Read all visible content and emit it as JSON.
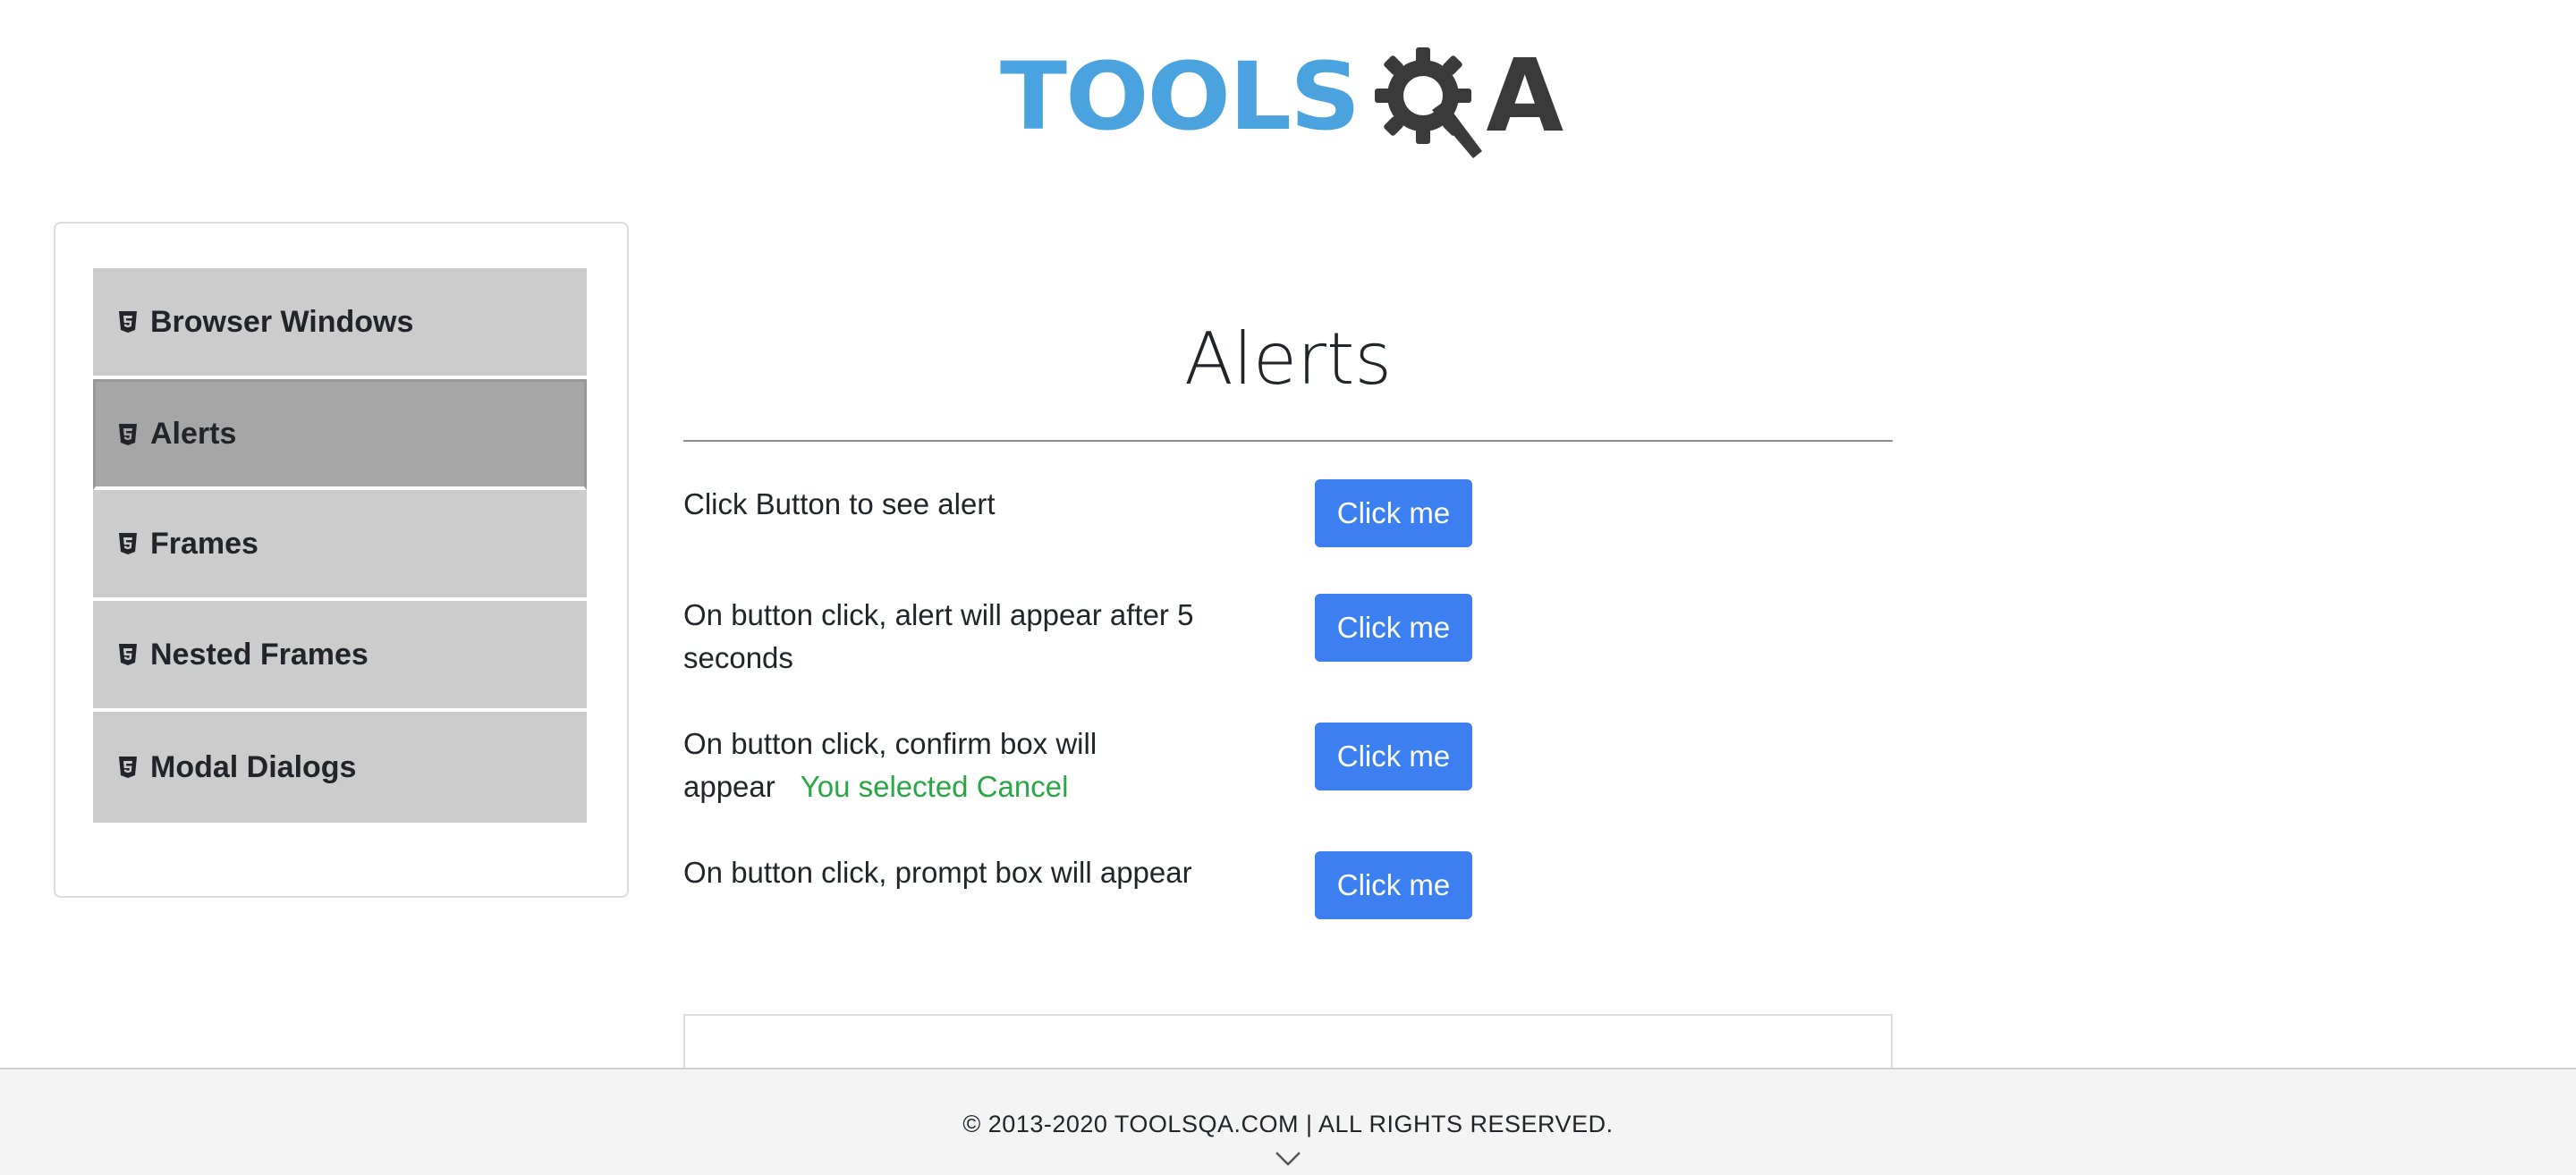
{
  "header": {
    "logo_text_primary": "TOOLS",
    "logo_text_secondary": "A",
    "logo_icon": "gear-q-icon",
    "colors": {
      "tools_blue": "#4aa3df",
      "qa_dark": "#3a3a3a"
    }
  },
  "sidebar": {
    "items": [
      {
        "label": "Browser Windows",
        "icon": "html5-icon",
        "active": false
      },
      {
        "label": "Alerts",
        "icon": "html5-icon",
        "active": true
      },
      {
        "label": "Frames",
        "icon": "html5-icon",
        "active": false
      },
      {
        "label": "Nested Frames",
        "icon": "html5-icon",
        "active": false
      },
      {
        "label": "Modal Dialogs",
        "icon": "html5-icon",
        "active": false
      }
    ]
  },
  "main": {
    "title": "Alerts",
    "rows": [
      {
        "text": "Click Button to see alert",
        "button": "Click me"
      },
      {
        "text": "On button click, alert will appear after 5 seconds",
        "button": "Click me"
      },
      {
        "text": "On button click, confirm box will appear",
        "result": "You selected Cancel",
        "button": "Click me"
      },
      {
        "text": "On button click, prompt box will appear",
        "button": "Click me"
      }
    ],
    "colors": {
      "button_bg": "#3b7ff0",
      "result_text": "#28a745"
    }
  },
  "footer": {
    "copyright": "© 2013-2020 TOOLSQA.COM | ALL RIGHTS RESERVED.",
    "scroll_icon": "chevron-down-icon"
  }
}
